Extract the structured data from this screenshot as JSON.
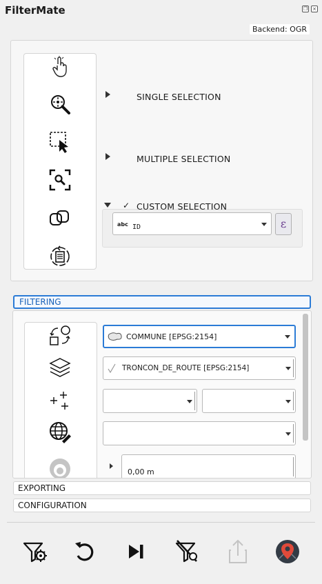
{
  "app": {
    "title": "FilterMate",
    "backend": "Backend: OGR"
  },
  "window_buttons": [
    "restore-icon",
    "close-icon"
  ],
  "selection_panel": {
    "icons": [
      "pointer-hand-icon",
      "zoom-target-icon",
      "select-rect-icon",
      "zoom-extent-icon",
      "identify-icon",
      "sync-refresh-icon"
    ],
    "sections": [
      {
        "label": "SINGLE SELECTION",
        "expanded": false
      },
      {
        "label": "MULTIPLE SELECTION",
        "expanded": false
      },
      {
        "label": "CUSTOM SELECTION",
        "expanded": true,
        "checked": true
      }
    ],
    "custom": {
      "field_type": "abc",
      "field_value": "ID",
      "expression_button": "ε"
    }
  },
  "tabs": {
    "filtering": "FILTERING",
    "exporting": "EXPORTING",
    "configuration": "CONFIGURATION"
  },
  "filtering": {
    "icons": [
      "layer-transform-icon",
      "layers-stack-icon",
      "add-points-icon",
      "globe-edit-icon",
      "buffer-circle-icon"
    ],
    "source_layer": "COMMUNE [EPSG:2154]",
    "target_layer": "TRONCON_DE_ROUTE [EPSG:2154]",
    "predicate_left": "",
    "predicate_right": "",
    "globe_combo": "",
    "buffer_value": "0,00 m"
  },
  "toolbar": [
    "filter-settings-icon",
    "undo-icon",
    "skip-next-icon",
    "unfilter-icon",
    "export-icon",
    "map-pin-icon"
  ],
  "colors": {
    "accent": "#2b7bd6",
    "map_pin": "#e04a3a"
  }
}
